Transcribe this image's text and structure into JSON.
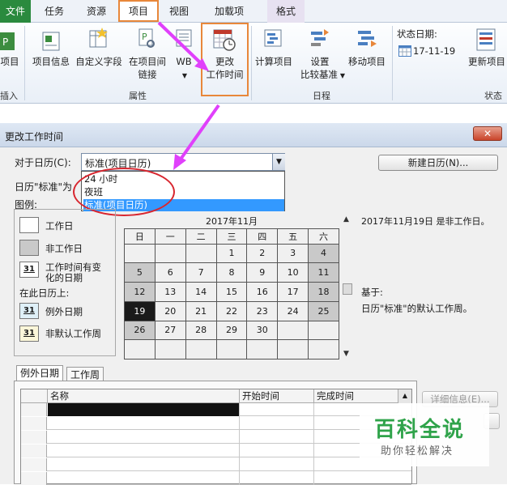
{
  "ribbon": {
    "tabs": [
      {
        "label": "文件"
      },
      {
        "label": "任务"
      },
      {
        "label": "资源"
      },
      {
        "label": "项目"
      },
      {
        "label": "视图"
      },
      {
        "label": "加载项"
      },
      {
        "label": "格式"
      }
    ],
    "buttons": {
      "project_left": "项目",
      "project_info": "项目信息",
      "custom_fields": "自定义字段",
      "links_1": "在项目间",
      "links_2": "链接",
      "wbs": "WB",
      "change_time_1": "更改",
      "change_time_2": "工作时间",
      "calc_project": "计算项目",
      "set_baseline_1": "设置",
      "set_baseline_2": "比较基准",
      "move_project": "移动项目",
      "status_date_label": "状态日期:",
      "status_date_value": "17-11-19",
      "update_project": "更新项目"
    },
    "groups": {
      "insert": "插入",
      "properties": "属性",
      "schedule": "日程",
      "status": "状态"
    }
  },
  "dialog": {
    "title": "更改工作时间",
    "close": "✕",
    "for_calendar_label": "对于日历(C):",
    "calendar_value": "标准(项目日历)",
    "calendar_options": [
      "24 小时",
      "夜班",
      "标准(项目日历)"
    ],
    "calendar_text": "日历\"标准\"为",
    "new_calendar_button": "新建日历(N)...",
    "legend_label": "图例:",
    "legend": {
      "working": "工作日",
      "nonworking": "非工作日",
      "edited_1": "工作时间有变",
      "edited_2": "化的日期",
      "on_this_calendar": "在此日历上:",
      "exception": "例外日期",
      "nondefault": "非默认工作周",
      "swatch_num": "31"
    },
    "month_title": "2017年11月",
    "weekdays": [
      "日",
      "一",
      "二",
      "三",
      "四",
      "五",
      "六"
    ],
    "weeks": [
      [
        "",
        "",
        "",
        "1",
        "2",
        "3",
        "4"
      ],
      [
        "5",
        "6",
        "7",
        "8",
        "9",
        "10",
        "11"
      ],
      [
        "12",
        "13",
        "14",
        "15",
        "16",
        "17",
        "18"
      ],
      [
        "19",
        "20",
        "21",
        "22",
        "23",
        "24",
        "25"
      ],
      [
        "26",
        "27",
        "28",
        "29",
        "30",
        "",
        ""
      ],
      [
        "",
        "",
        "",
        "",
        "",
        "",
        ""
      ]
    ],
    "selected_day": "19",
    "info_line": "2017年11月19日 是非工作日。",
    "based_on": "基于:",
    "based_on_text": "日历\"标准\"的默认工作周。",
    "tabs": [
      "例外日期",
      "工作周"
    ],
    "grid_headers": [
      "名称",
      "开始时间",
      "完成时间"
    ],
    "details_button": "详细信息(E)...",
    "colors": {
      "accent_orange": "#e8873a",
      "selection_blue": "#3399ff",
      "circle_red": "#d8262f",
      "arrow_magenta": "#e040fb"
    }
  },
  "watermark": {
    "title": "百科全说",
    "subtitle": "助你轻松解决"
  }
}
